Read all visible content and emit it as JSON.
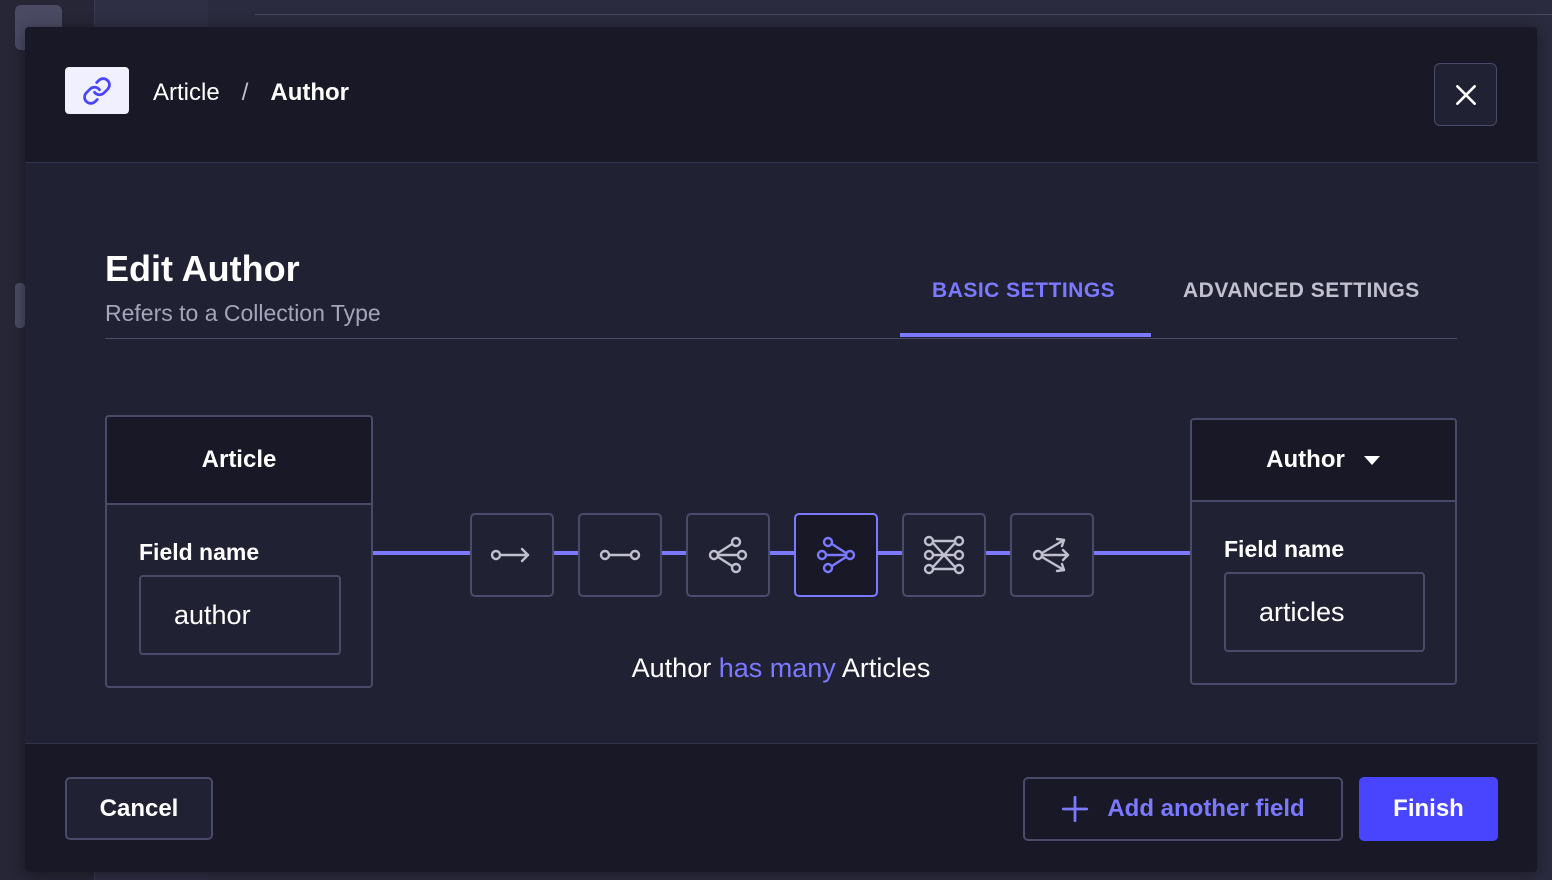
{
  "header": {
    "breadcrumb_1": "Article",
    "separator": "/",
    "breadcrumb_2": "Author",
    "icon": "link-icon"
  },
  "main": {
    "title": "Edit Author",
    "subtitle": "Refers to a Collection Type",
    "tabs": [
      {
        "label": "BASIC SETTINGS",
        "active": true
      },
      {
        "label": "ADVANCED SETTINGS",
        "active": false
      }
    ]
  },
  "left_box": {
    "title": "Article",
    "field_label": "Field name",
    "field_value": "author"
  },
  "right_box": {
    "title": "Author",
    "field_label": "Field name",
    "field_value": "articles"
  },
  "relation_types": [
    {
      "icon": "one-way-icon",
      "active": false
    },
    {
      "icon": "one-to-one-icon",
      "active": false
    },
    {
      "icon": "one-to-many-icon",
      "active": false
    },
    {
      "icon": "many-to-one-icon",
      "active": true
    },
    {
      "icon": "many-to-many-icon",
      "active": false
    },
    {
      "icon": "many-way-icon",
      "active": false
    }
  ],
  "relation_sentence": {
    "subject": "Author",
    "verb": "has many",
    "object": "Articles"
  },
  "footer": {
    "cancel_label": "Cancel",
    "add_label": "Add another field",
    "finish_label": "Finish"
  },
  "colors": {
    "accent": "#7b79ff",
    "primary": "#4945ff",
    "background": "#212134",
    "header": "#181826"
  }
}
